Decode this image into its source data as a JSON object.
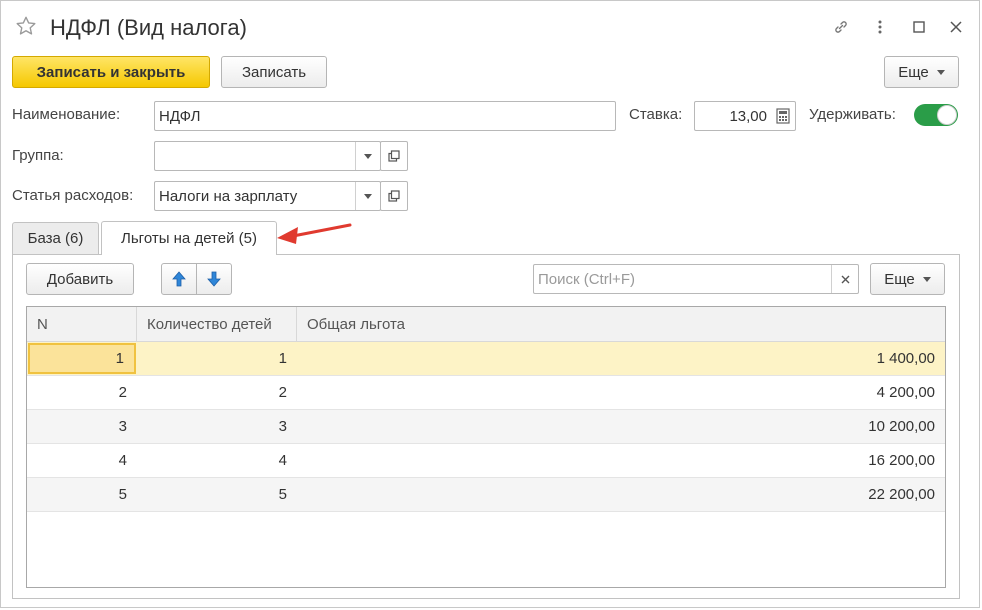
{
  "window": {
    "title": "НДФЛ (Вид налога)"
  },
  "toolbar": {
    "save_close_label": "Записать и закрыть",
    "save_label": "Записать",
    "more_label": "Еще"
  },
  "form": {
    "name_label": "Наименование:",
    "name_value": "НДФЛ",
    "rate_label": "Ставка:",
    "rate_value": "13,00",
    "withhold_label": "Удерживать:",
    "withhold_on": true,
    "group_label": "Группа:",
    "group_value": "",
    "expense_label": "Статья расходов:",
    "expense_value": "Налоги на зарплату"
  },
  "tabs": [
    {
      "label": "База (6)",
      "active": false
    },
    {
      "label": "Льготы на детей (5)",
      "active": true
    }
  ],
  "table_toolbar": {
    "add_label": "Добавить",
    "search_placeholder": "Поиск (Ctrl+F)",
    "more_label": "Еще"
  },
  "table": {
    "columns": [
      "N",
      "Количество детей",
      "Общая льгота"
    ],
    "rows": [
      {
        "n": "1",
        "children": "1",
        "benefit": "1 400,00"
      },
      {
        "n": "2",
        "children": "2",
        "benefit": "4 200,00"
      },
      {
        "n": "3",
        "children": "3",
        "benefit": "10 200,00"
      },
      {
        "n": "4",
        "children": "4",
        "benefit": "16 200,00"
      },
      {
        "n": "5",
        "children": "5",
        "benefit": "22 200,00"
      }
    ],
    "selected_row": 0
  },
  "colors": {
    "accent_yellow": "#f5c800",
    "toggle_green": "#2a9d48",
    "selected_row": "#fdf3c6",
    "annotation_arrow": "#e03a2f",
    "arrow_blue": "#2f86d8"
  }
}
